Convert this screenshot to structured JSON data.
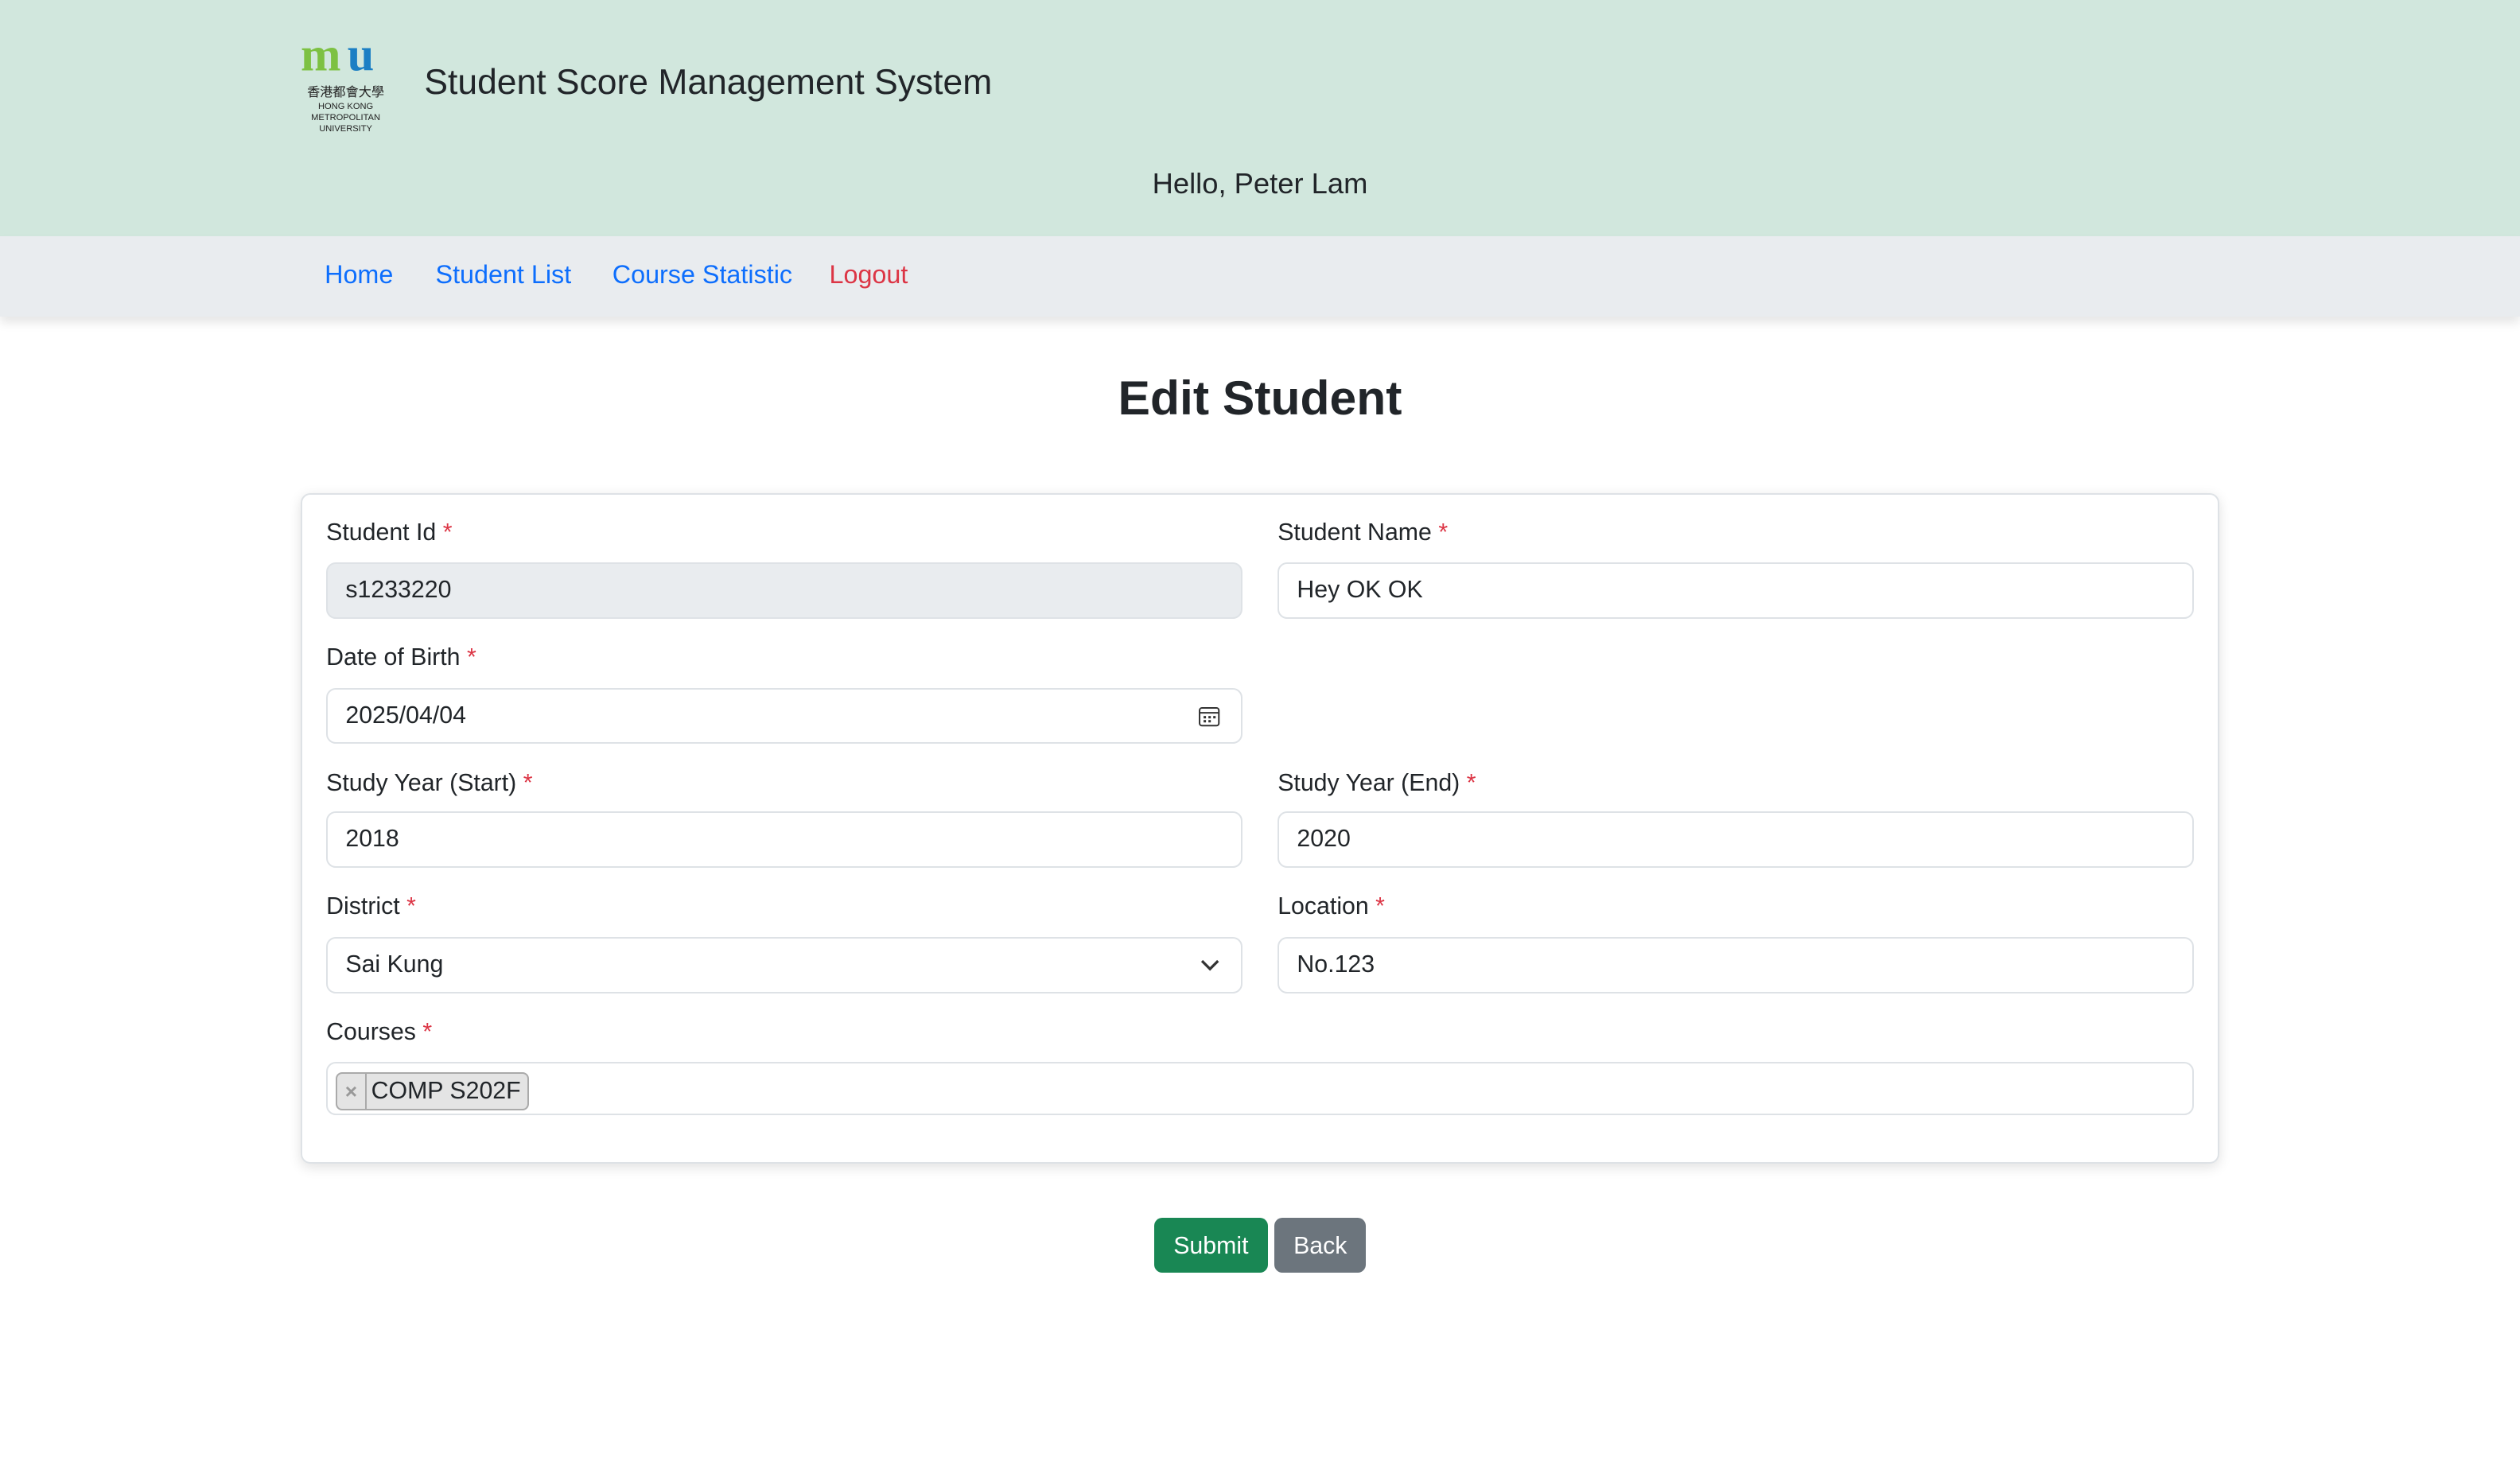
{
  "header": {
    "logo_text": "HONG KONG METROPOLITAN UNIVERSITY",
    "logo_chinese": "香港都會大學",
    "title": "Student Score Management System",
    "greeting": "Hello, Peter Lam"
  },
  "nav": {
    "home": "Home",
    "student_list": "Student List",
    "course_statistic": "Course Statistic",
    "logout": "Logout"
  },
  "page_title": "Edit Student",
  "form": {
    "required_mark": "*",
    "student_id": {
      "label": "Student Id",
      "value": "s1233220"
    },
    "student_name": {
      "label": "Student Name",
      "value": "Hey OK OK"
    },
    "dob": {
      "label": "Date of Birth",
      "value": "2025/04/04"
    },
    "year_start": {
      "label": "Study Year (Start)",
      "value": "2018"
    },
    "year_end": {
      "label": "Study Year (End)",
      "value": "2020"
    },
    "district": {
      "label": "District",
      "value": "Sai Kung"
    },
    "location": {
      "label": "Location",
      "value": "No.123"
    },
    "courses": {
      "label": "Courses",
      "remove": "×",
      "items": [
        "COMP S202F"
      ]
    }
  },
  "buttons": {
    "submit": "Submit",
    "back": "Back"
  },
  "colors": {
    "header": "#d1e7dd",
    "link": "#0d6efd",
    "logout": "#dc3545",
    "submit": "#198754",
    "back": "#6c757d"
  }
}
